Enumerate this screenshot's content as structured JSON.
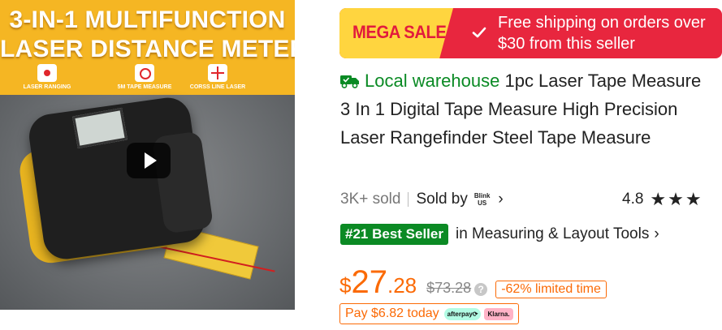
{
  "image": {
    "title_line1": "3-IN-1 MULTIFUNCTION",
    "title_line2": "LASER DISTANCE METER",
    "features": [
      "LASER RANGING",
      "5M TAPE MEASURE",
      "CORSS LINE LASER"
    ]
  },
  "banner": {
    "sale_label": "MEGA SALE",
    "shipping_line1": "Free shipping on orders over",
    "shipping_line2": "$30 from this seller"
  },
  "product": {
    "warehouse_label": "Local warehouse",
    "title": "1pc Laser Tape Measure 3 In 1 Digital Tape Measure High Precision Laser Rangefinder Steel Tape Measure"
  },
  "sales": {
    "sold": "3K+ sold",
    "sold_by": "Sold by",
    "seller_line1": "Blink",
    "seller_line2": "US",
    "rating": "4.8",
    "stars": "★★★"
  },
  "best_seller": {
    "badge": "#21 Best Seller",
    "category": "in Measuring & Layout Tools"
  },
  "price": {
    "currency": "$",
    "integer": "27",
    "decimal": ".28",
    "original": "$73.28",
    "discount": "-62% limited time"
  },
  "installment": {
    "text": "Pay $6.82 today",
    "afterpay": "afterpay⟳",
    "klarna": "Klarna."
  },
  "colors": {
    "accent_price": "#fb6a06",
    "warehouse_green": "#0a8a24",
    "sale_red": "#e8263e",
    "sale_yellow": "#ffd53f"
  }
}
